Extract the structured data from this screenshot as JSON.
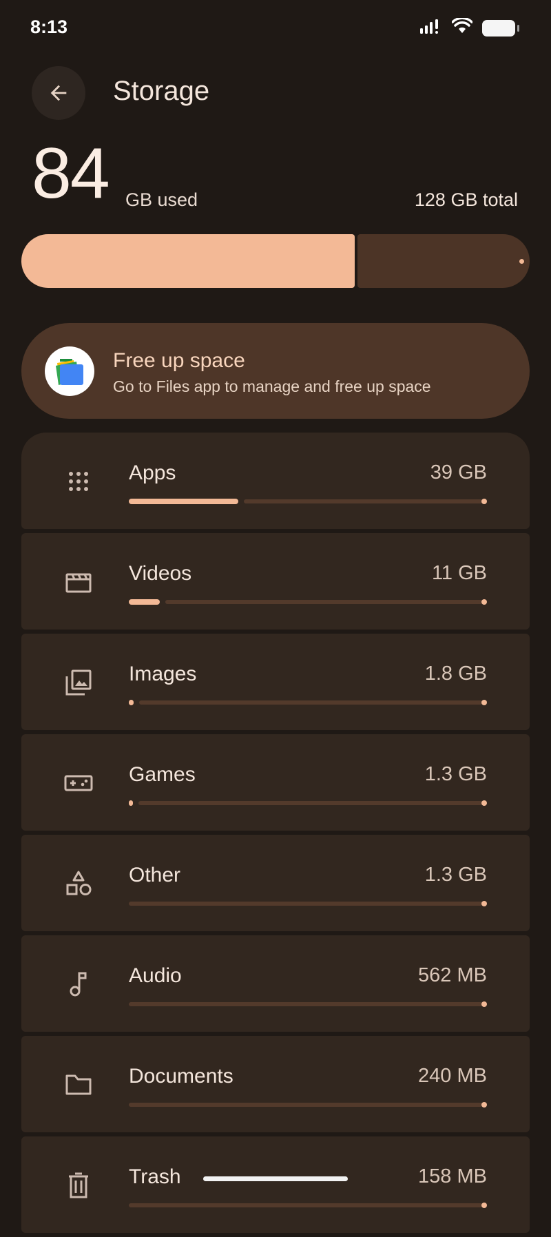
{
  "status_bar": {
    "time": "8:13"
  },
  "header": {
    "title": "Storage"
  },
  "summary": {
    "used_value": "84",
    "used_unit": "GB used",
    "total": "128 GB total",
    "used_fraction": 0.656
  },
  "free_up": {
    "title": "Free up space",
    "subtitle": "Go to Files app to manage and free up space"
  },
  "categories": [
    {
      "key": "apps",
      "name": "Apps",
      "size": "39 GB",
      "icon": "apps-grid-icon",
      "fraction": 0.305
    },
    {
      "key": "videos",
      "name": "Videos",
      "size": "11 GB",
      "icon": "movie-icon",
      "fraction": 0.086
    },
    {
      "key": "images",
      "name": "Images",
      "size": "1.8 GB",
      "icon": "photo-library-icon",
      "fraction": 0.014
    },
    {
      "key": "games",
      "name": "Games",
      "size": "1.3 GB",
      "icon": "gamepad-icon",
      "fraction": 0.01
    },
    {
      "key": "other",
      "name": "Other",
      "size": "1.3 GB",
      "icon": "shapes-icon",
      "fraction": 0.0
    },
    {
      "key": "audio",
      "name": "Audio",
      "size": "562 MB",
      "icon": "music-note-icon",
      "fraction": 0.0
    },
    {
      "key": "documents",
      "name": "Documents",
      "size": "240 MB",
      "icon": "folder-icon",
      "fraction": 0.0
    },
    {
      "key": "trash",
      "name": "Trash",
      "size": "158 MB",
      "icon": "trash-icon",
      "fraction": 0.0
    }
  ],
  "colors": {
    "accent": "#f3b996",
    "track": "#533a2b",
    "background": "#1f1915",
    "card": "#32271f"
  }
}
